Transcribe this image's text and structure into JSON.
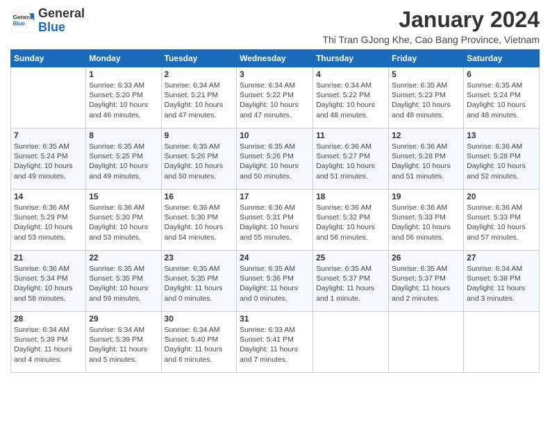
{
  "logo": {
    "name_part1": "General",
    "name_part2": "Blue"
  },
  "title": "January 2024",
  "location": "Thi Tran GJong Khe, Cao Bang Province, Vietnam",
  "days_of_week": [
    "Sunday",
    "Monday",
    "Tuesday",
    "Wednesday",
    "Thursday",
    "Friday",
    "Saturday"
  ],
  "weeks": [
    [
      {
        "day": "",
        "info": ""
      },
      {
        "day": "1",
        "info": "Sunrise: 6:33 AM\nSunset: 5:20 PM\nDaylight: 10 hours\nand 46 minutes."
      },
      {
        "day": "2",
        "info": "Sunrise: 6:34 AM\nSunset: 5:21 PM\nDaylight: 10 hours\nand 47 minutes."
      },
      {
        "day": "3",
        "info": "Sunrise: 6:34 AM\nSunset: 5:22 PM\nDaylight: 10 hours\nand 47 minutes."
      },
      {
        "day": "4",
        "info": "Sunrise: 6:34 AM\nSunset: 5:22 PM\nDaylight: 10 hours\nand 48 minutes."
      },
      {
        "day": "5",
        "info": "Sunrise: 6:35 AM\nSunset: 5:23 PM\nDaylight: 10 hours\nand 48 minutes."
      },
      {
        "day": "6",
        "info": "Sunrise: 6:35 AM\nSunset: 5:24 PM\nDaylight: 10 hours\nand 48 minutes."
      }
    ],
    [
      {
        "day": "7",
        "info": "Sunrise: 6:35 AM\nSunset: 5:24 PM\nDaylight: 10 hours\nand 49 minutes."
      },
      {
        "day": "8",
        "info": "Sunrise: 6:35 AM\nSunset: 5:25 PM\nDaylight: 10 hours\nand 49 minutes."
      },
      {
        "day": "9",
        "info": "Sunrise: 6:35 AM\nSunset: 5:26 PM\nDaylight: 10 hours\nand 50 minutes."
      },
      {
        "day": "10",
        "info": "Sunrise: 6:35 AM\nSunset: 5:26 PM\nDaylight: 10 hours\nand 50 minutes."
      },
      {
        "day": "11",
        "info": "Sunrise: 6:36 AM\nSunset: 5:27 PM\nDaylight: 10 hours\nand 51 minutes."
      },
      {
        "day": "12",
        "info": "Sunrise: 6:36 AM\nSunset: 5:28 PM\nDaylight: 10 hours\nand 51 minutes."
      },
      {
        "day": "13",
        "info": "Sunrise: 6:36 AM\nSunset: 5:28 PM\nDaylight: 10 hours\nand 52 minutes."
      }
    ],
    [
      {
        "day": "14",
        "info": "Sunrise: 6:36 AM\nSunset: 5:29 PM\nDaylight: 10 hours\nand 53 minutes."
      },
      {
        "day": "15",
        "info": "Sunrise: 6:36 AM\nSunset: 5:30 PM\nDaylight: 10 hours\nand 53 minutes."
      },
      {
        "day": "16",
        "info": "Sunrise: 6:36 AM\nSunset: 5:30 PM\nDaylight: 10 hours\nand 54 minutes."
      },
      {
        "day": "17",
        "info": "Sunrise: 6:36 AM\nSunset: 5:31 PM\nDaylight: 10 hours\nand 55 minutes."
      },
      {
        "day": "18",
        "info": "Sunrise: 6:36 AM\nSunset: 5:32 PM\nDaylight: 10 hours\nand 56 minutes."
      },
      {
        "day": "19",
        "info": "Sunrise: 6:36 AM\nSunset: 5:33 PM\nDaylight: 10 hours\nand 56 minutes."
      },
      {
        "day": "20",
        "info": "Sunrise: 6:36 AM\nSunset: 5:33 PM\nDaylight: 10 hours\nand 57 minutes."
      }
    ],
    [
      {
        "day": "21",
        "info": "Sunrise: 6:36 AM\nSunset: 5:34 PM\nDaylight: 10 hours\nand 58 minutes."
      },
      {
        "day": "22",
        "info": "Sunrise: 6:35 AM\nSunset: 5:35 PM\nDaylight: 10 hours\nand 59 minutes."
      },
      {
        "day": "23",
        "info": "Sunrise: 6:35 AM\nSunset: 5:35 PM\nDaylight: 11 hours\nand 0 minutes."
      },
      {
        "day": "24",
        "info": "Sunrise: 6:35 AM\nSunset: 5:36 PM\nDaylight: 11 hours\nand 0 minutes."
      },
      {
        "day": "25",
        "info": "Sunrise: 6:35 AM\nSunset: 5:37 PM\nDaylight: 11 hours\nand 1 minute."
      },
      {
        "day": "26",
        "info": "Sunrise: 6:35 AM\nSunset: 5:37 PM\nDaylight: 11 hours\nand 2 minutes."
      },
      {
        "day": "27",
        "info": "Sunrise: 6:34 AM\nSunset: 5:38 PM\nDaylight: 11 hours\nand 3 minutes."
      }
    ],
    [
      {
        "day": "28",
        "info": "Sunrise: 6:34 AM\nSunset: 5:39 PM\nDaylight: 11 hours\nand 4 minutes."
      },
      {
        "day": "29",
        "info": "Sunrise: 6:34 AM\nSunset: 5:39 PM\nDaylight: 11 hours\nand 5 minutes."
      },
      {
        "day": "30",
        "info": "Sunrise: 6:34 AM\nSunset: 5:40 PM\nDaylight: 11 hours\nand 6 minutes."
      },
      {
        "day": "31",
        "info": "Sunrise: 6:33 AM\nSunset: 5:41 PM\nDaylight: 11 hours\nand 7 minutes."
      },
      {
        "day": "",
        "info": ""
      },
      {
        "day": "",
        "info": ""
      },
      {
        "day": "",
        "info": ""
      }
    ]
  ]
}
